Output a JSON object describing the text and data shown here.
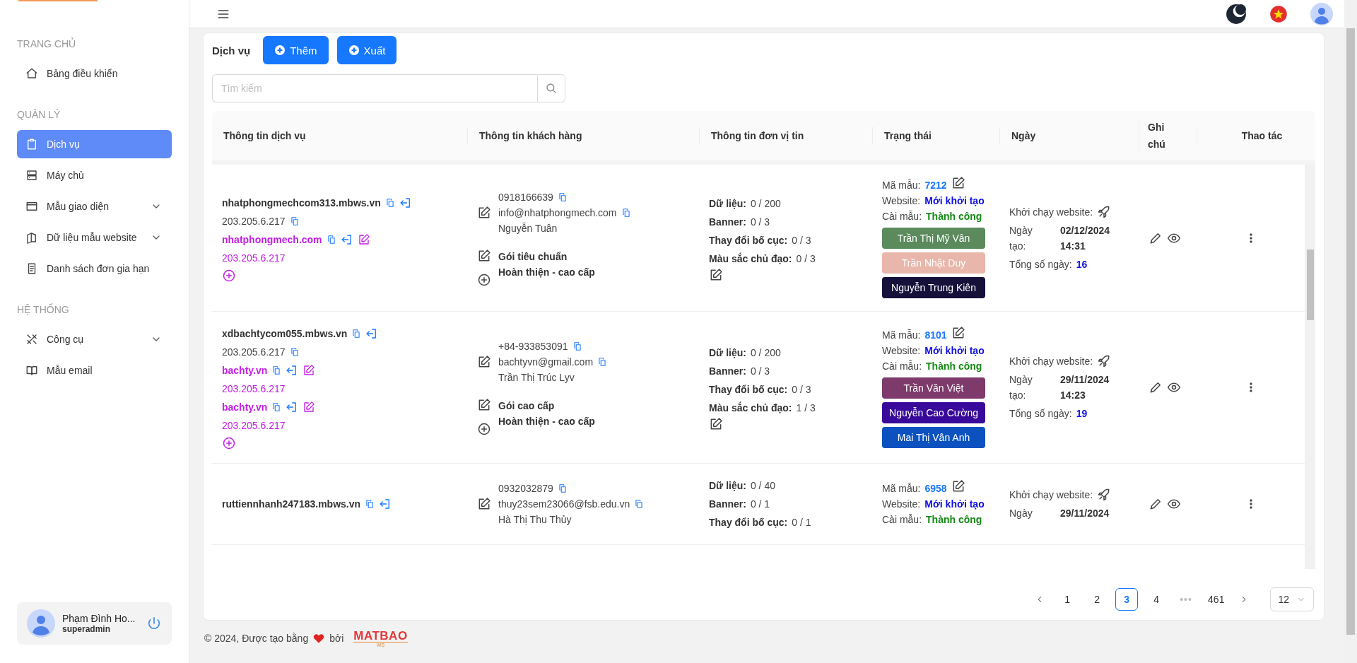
{
  "sidebar": {
    "groups": [
      {
        "title": "TRANG CHỦ",
        "items": [
          {
            "label": "Bảng điều khiển",
            "selected": false,
            "has_submenu": false
          }
        ]
      },
      {
        "title": "QUẢN LÝ",
        "items": [
          {
            "label": "Dịch vụ",
            "selected": true,
            "has_submenu": false
          },
          {
            "label": "Máy chủ",
            "selected": false,
            "has_submenu": false
          },
          {
            "label": "Mẫu giao diện",
            "selected": false,
            "has_submenu": true
          },
          {
            "label": "Dữ liệu mẫu website",
            "selected": false,
            "has_submenu": true
          },
          {
            "label": "Danh sách đơn gia hạn",
            "selected": false,
            "has_submenu": false
          }
        ]
      },
      {
        "title": "HỆ THỐNG",
        "items": [
          {
            "label": "Công cụ",
            "selected": false,
            "has_submenu": true
          },
          {
            "label": "Mẫu email",
            "selected": false,
            "has_submenu": false
          }
        ]
      }
    ],
    "user": {
      "name": "Phạm Đình Ho...",
      "role": "superadmin"
    }
  },
  "page": {
    "title": "Dịch vụ",
    "buttons": [
      "Thêm",
      "Xuất"
    ],
    "search": {
      "placeholder": "Tìm kiếm"
    }
  },
  "table": {
    "columns": [
      "Thông tin dịch vụ",
      "Thông tin khách hàng",
      "Thông tin đơn vị tin",
      "Trạng thái",
      "Ngày",
      "Ghi chú",
      "Thao tác"
    ],
    "rows": [
      {
        "domain": "nhatphongmechcom313.mbws.vn",
        "ip": "203.205.6.217",
        "subdomains": [
          {
            "domain": "nhatphongmech.com",
            "ip": "203.205.6.217"
          }
        ],
        "customer": {
          "phone": "0918166639",
          "email": "info@nhatphongmech.com",
          "name": "Nguyễn Tuân",
          "package": "Gói tiêu chuẩn",
          "package_level": "Hoàn thiện - cao cấp"
        },
        "quotas": [
          {
            "label": "Dữ liệu:",
            "value": "0 / 200"
          },
          {
            "label": "Banner:",
            "value": "0 / 3"
          },
          {
            "label": "Thay đổi bố cục:",
            "value": "0 / 3"
          },
          {
            "label": "Màu sắc chủ đạo:",
            "value": "0 / 3"
          }
        ],
        "status": {
          "template_label": "Mã mẫu:",
          "template_code": "7212",
          "website_label": "Website:",
          "website_status": "Mới khởi tạo",
          "install_label": "Cài mẫu:",
          "install_status": "Thành công",
          "assignees": [
            {
              "name": "Trần Thị Mỹ Vân",
              "color": "#5b8a5d"
            },
            {
              "name": "Trần Nhật Duy",
              "color": "#e8b6ab"
            },
            {
              "name": "Nguyễn Trung Kiên",
              "color": "#16113a"
            }
          ]
        },
        "dates": {
          "launch_label": "Khởi chạy website:",
          "created_label": "Ngày tạo:",
          "created_date": "02/12/2024",
          "created_time": "14:31",
          "total_label": "Tổng số ngày:",
          "total": "16"
        }
      },
      {
        "domain": "xdbachtycom055.mbws.vn",
        "ip": "203.205.6.217",
        "subdomains": [
          {
            "domain": "bachty.vn",
            "ip": "203.205.6.217"
          },
          {
            "domain": "bachty.vn",
            "ip": "203.205.6.217"
          }
        ],
        "customer": {
          "phone": "+84-933853091",
          "email": "bachtyvn@gmail.com",
          "name": "Trần Thị Trúc Lyv",
          "package": "Gói cao cấp",
          "package_level": "Hoàn thiện - cao cấp"
        },
        "quotas": [
          {
            "label": "Dữ liệu:",
            "value": "0 / 200"
          },
          {
            "label": "Banner:",
            "value": "0 / 3"
          },
          {
            "label": "Thay đổi bố cục:",
            "value": "0 / 3"
          },
          {
            "label": "Màu sắc chủ đạo:",
            "value": "1 / 3"
          }
        ],
        "status": {
          "template_label": "Mã mẫu:",
          "template_code": "8101",
          "website_label": "Website:",
          "website_status": "Mới khởi tạo",
          "install_label": "Cài mẫu:",
          "install_status": "Thành công",
          "assignees": [
            {
              "name": "Trần Văn Việt",
              "color": "#7e3a6b"
            },
            {
              "name": "Nguyễn Cao Cường",
              "color": "#38099a"
            },
            {
              "name": "Mai Thị Vân Anh",
              "color": "#0b52c0"
            }
          ]
        },
        "dates": {
          "launch_label": "Khởi chạy website:",
          "created_label": "Ngày tạo:",
          "created_date": "29/11/2024",
          "created_time": "14:23",
          "total_label": "Tổng số ngày:",
          "total": "19"
        }
      },
      {
        "domain": "ruttiennhanh247183.mbws.vn",
        "subdomains": [],
        "customer": {
          "phone": "0932032879",
          "email": "thuy23sem23066@fsb.edu.vn",
          "name": "Hà Thị Thu Thủy"
        },
        "quotas": [
          {
            "label": "Dữ liệu:",
            "value": "0 / 40"
          },
          {
            "label": "Banner:",
            "value": "0 / 1"
          },
          {
            "label": "Thay đổi bố cục:",
            "value": "0 / 1"
          }
        ],
        "status": {
          "template_label": "Mã mẫu:",
          "template_code": "6958",
          "website_label": "Website:",
          "website_status": "Mới khởi tạo",
          "install_label": "Cài mẫu:",
          "install_status": "Thành công"
        },
        "dates": {
          "launch_label": "Khởi chạy website:",
          "created_label": "Ngày",
          "created_date": "29/11/2024"
        }
      }
    ]
  },
  "pagination": {
    "items": [
      {
        "kind": "page",
        "label": "1",
        "selected": false
      },
      {
        "kind": "page",
        "label": "2",
        "selected": false
      },
      {
        "kind": "page",
        "label": "3",
        "selected": true
      },
      {
        "kind": "page",
        "label": "4",
        "selected": false
      },
      {
        "kind": "more",
        "label": "•••",
        "selected": false
      },
      {
        "kind": "page",
        "label": "461",
        "selected": false
      }
    ],
    "page_size": "12"
  },
  "footer": {
    "text": "© 2024, Được tạo bằng",
    "by": "bởi",
    "brand": "MATBAO",
    "brand_sub": "WS"
  }
}
